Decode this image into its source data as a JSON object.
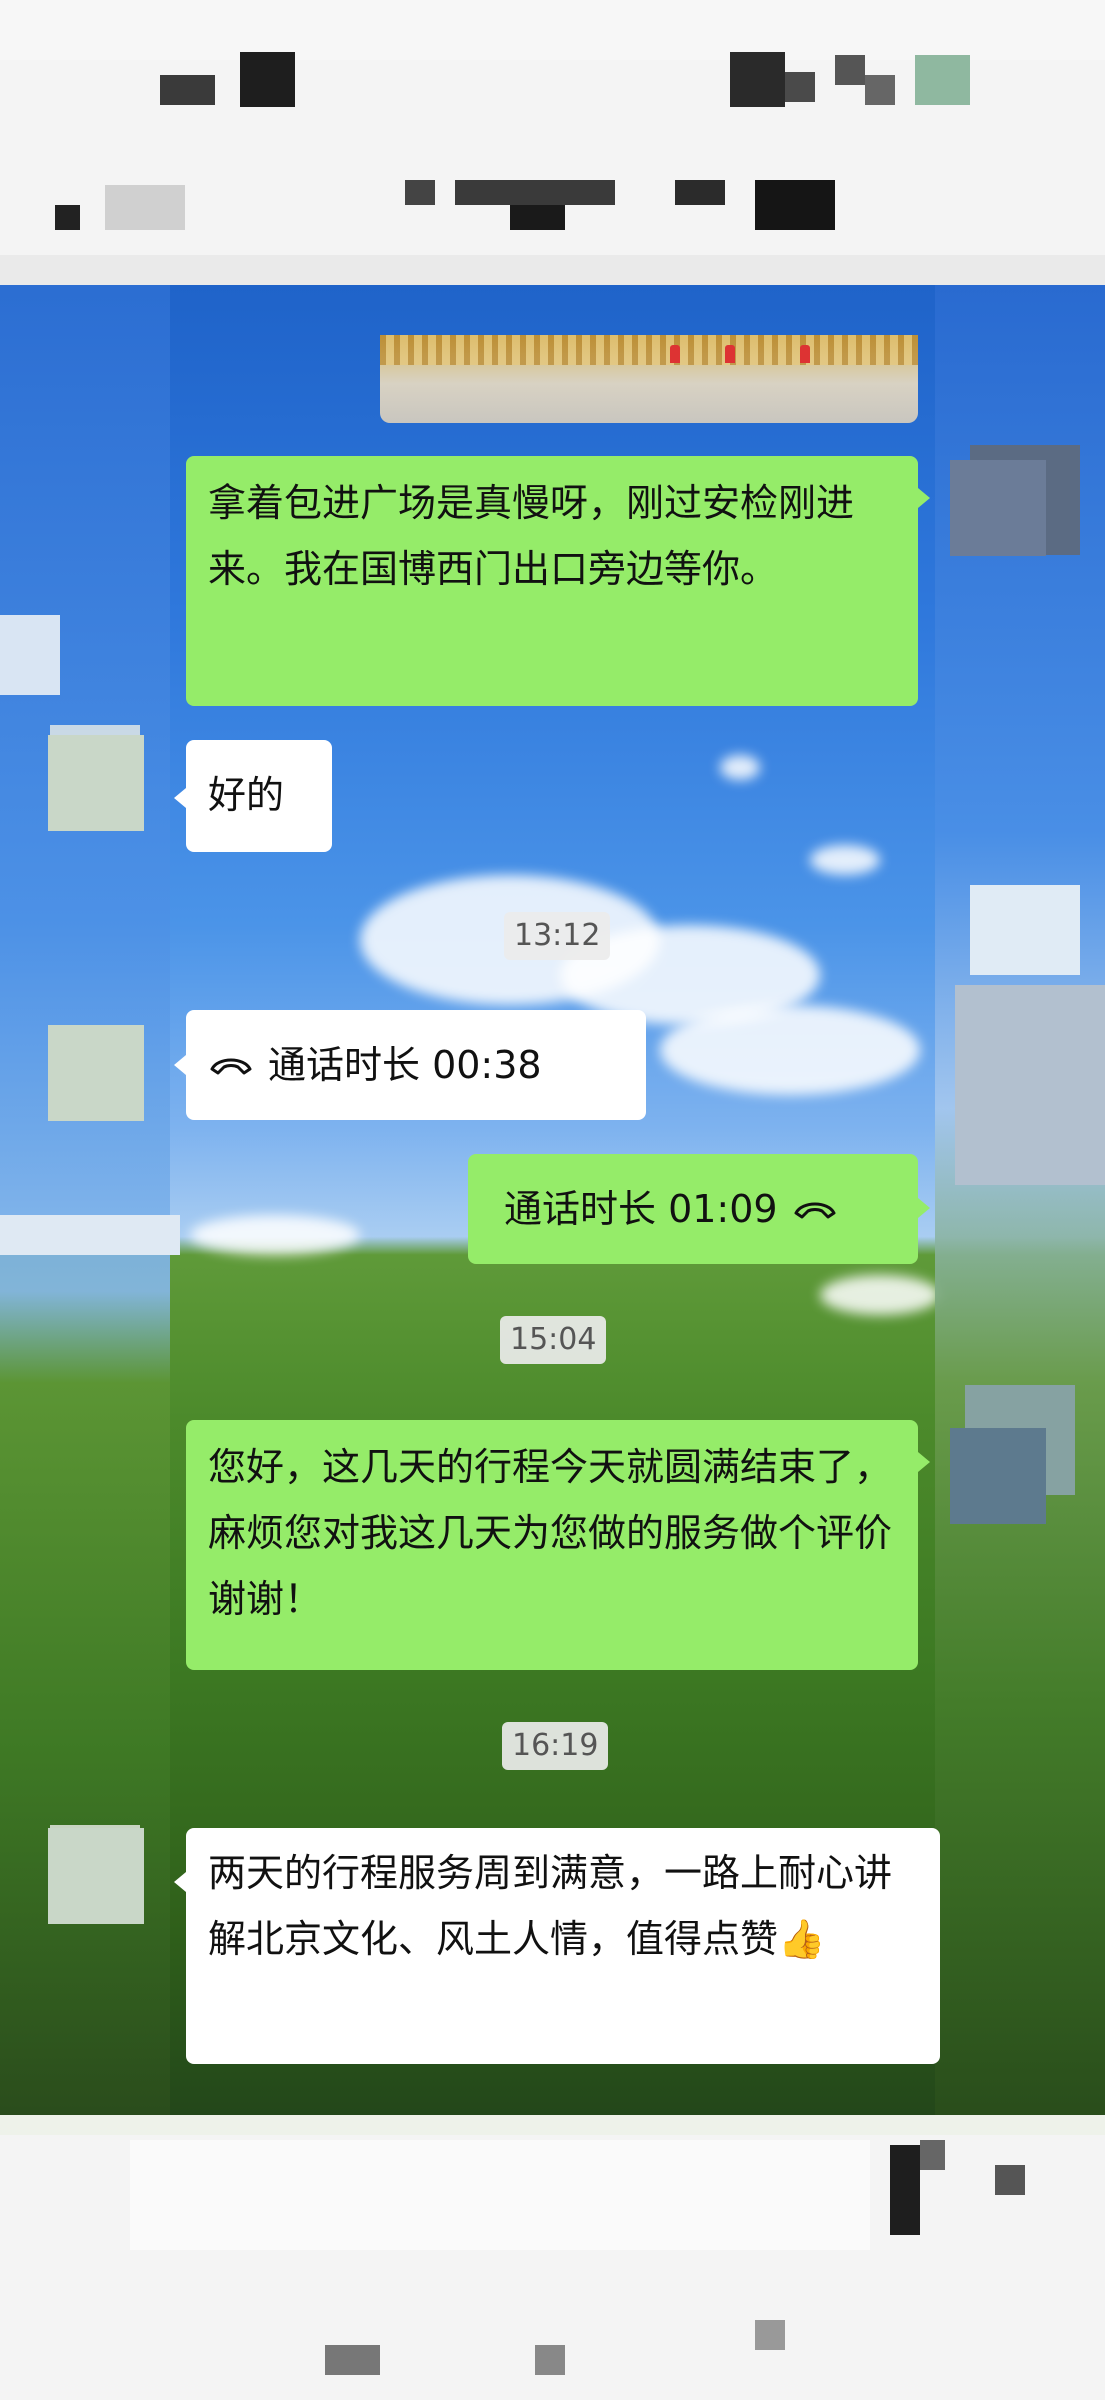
{
  "messages": [
    {
      "side": "me",
      "text": "拿着包进广场是真慢呀，刚过安检刚进来。我在国博西门出口旁边等你。"
    },
    {
      "side": "them",
      "text": "好的"
    },
    {
      "side": "time",
      "text": "13:12"
    },
    {
      "side": "them",
      "type": "call",
      "text": "通话时长 00:38"
    },
    {
      "side": "me",
      "type": "call",
      "text": "通话时长 01:09"
    },
    {
      "side": "time",
      "text": "15:04"
    },
    {
      "side": "me",
      "text": "您好，这几天的行程今天就圆满结束了， 麻烦您对我这几天为您做的服务做个评价 谢谢！"
    },
    {
      "side": "time",
      "text": "16:19"
    },
    {
      "side": "them",
      "text": "两天的行程服务周到满意，一路上耐心讲解北京文化、风土人情，值得点赞👍"
    }
  ],
  "colors": {
    "my_bubble": "#95ec69",
    "their_bubble": "#ffffff"
  },
  "icons": {
    "call": "phone-handset-icon"
  }
}
